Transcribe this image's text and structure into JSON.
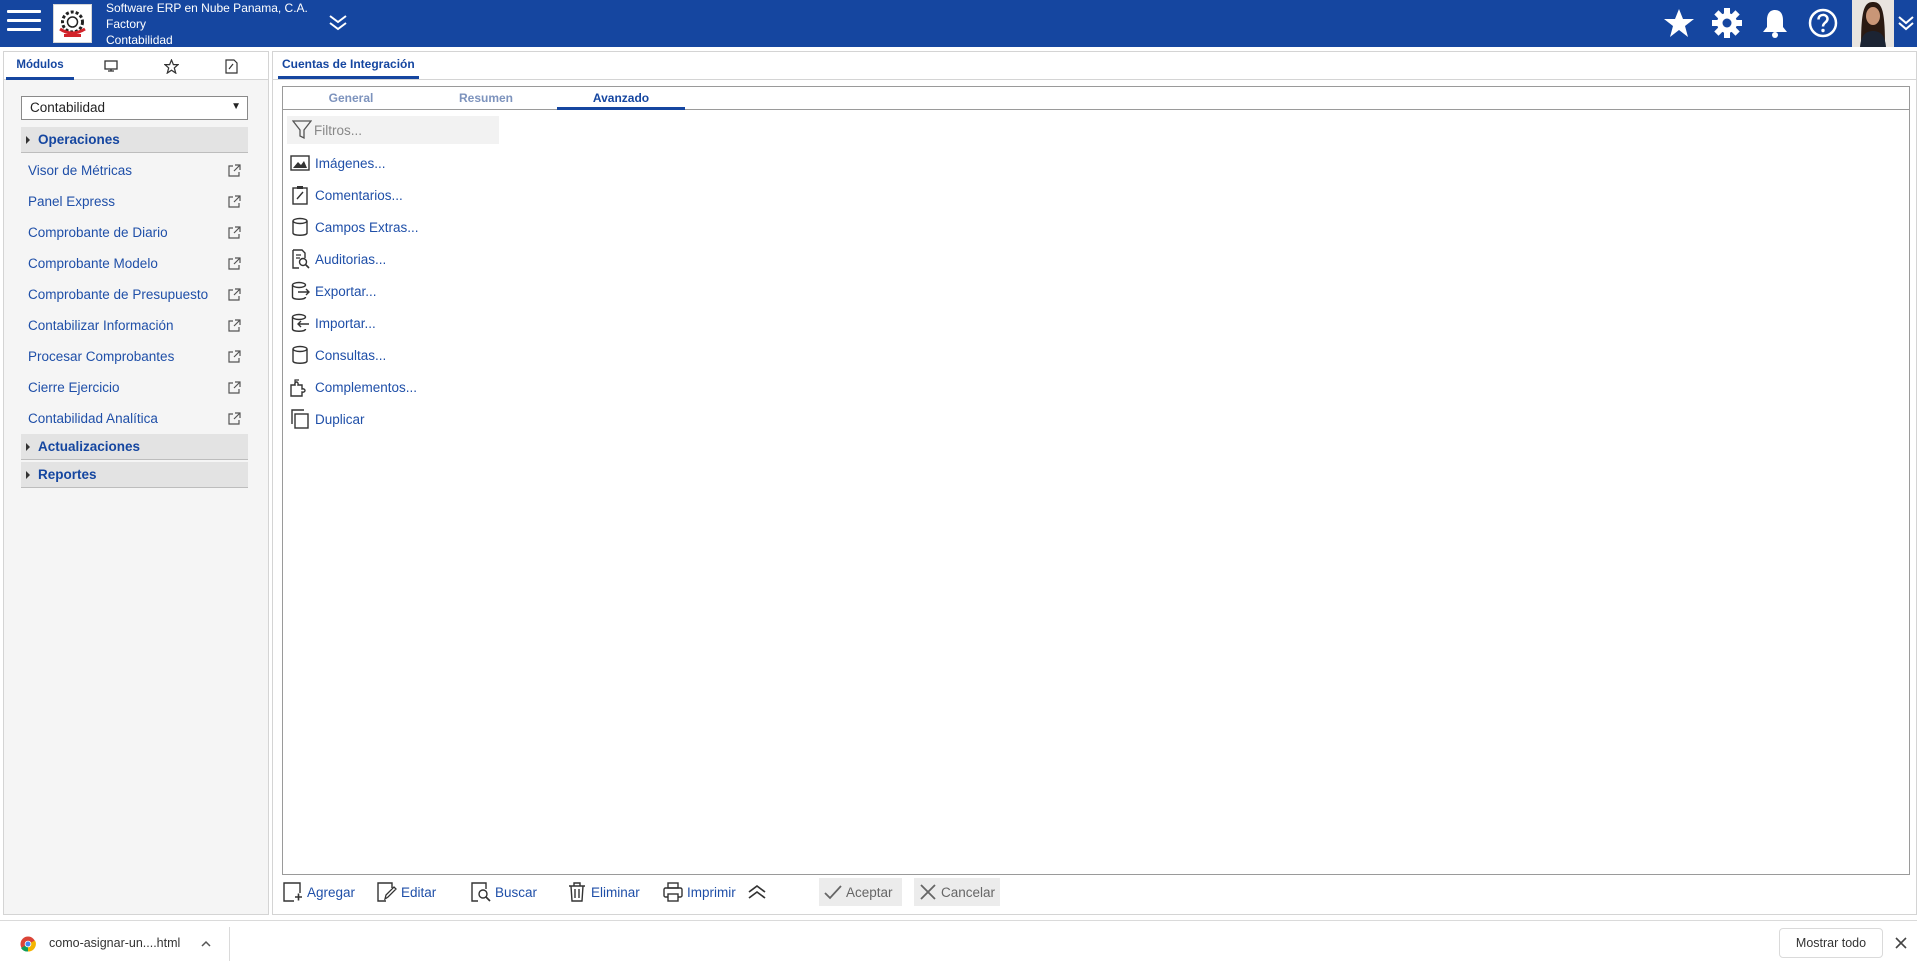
{
  "header": {
    "company_name": "Software ERP en Nube Panama, C.A.",
    "branch": "Factory",
    "module": "Contabilidad",
    "icons": [
      "menu-icon",
      "company-logo",
      "expand-icon",
      "star-icon",
      "gear-icon",
      "bell-icon",
      "help-icon",
      "avatar",
      "chevron-down-icon"
    ],
    "accent_color": "#1546a0"
  },
  "left_panel": {
    "tabs": [
      {
        "label": "Módulos",
        "icon": ""
      },
      {
        "label": "",
        "icon": "monitor-icon"
      },
      {
        "label": "",
        "icon": "star-outline-icon"
      },
      {
        "label": "",
        "icon": "document-link-icon"
      }
    ],
    "module_select": "Contabilidad",
    "sections": [
      {
        "label": "Operaciones",
        "expanded": true
      },
      {
        "label": "Actualizaciones",
        "expanded": false
      },
      {
        "label": "Reportes",
        "expanded": false
      }
    ],
    "operations": [
      "Visor de Métricas",
      "Panel Express",
      "Comprobante de Diario",
      "Comprobante Modelo",
      "Comprobante de Presupuesto",
      "Contabilizar Información",
      "Procesar Comprobantes",
      "Cierre Ejercicio",
      "Contabilidad Analítica"
    ]
  },
  "main": {
    "tab_title": "Cuentas de Integración",
    "subtabs": [
      {
        "label": "General",
        "active": false
      },
      {
        "label": "Resumen",
        "active": false
      },
      {
        "label": "Avanzado",
        "active": true
      }
    ],
    "filter_placeholder": "Filtros...",
    "actions": [
      {
        "label": "Imágenes...",
        "icon": "image-icon"
      },
      {
        "label": "Comentarios...",
        "icon": "clipboard-icon"
      },
      {
        "label": "Campos Extras...",
        "icon": "database-icon"
      },
      {
        "label": "Auditorias...",
        "icon": "audit-icon"
      },
      {
        "label": "Exportar...",
        "icon": "export-icon"
      },
      {
        "label": "Importar...",
        "icon": "import-icon"
      },
      {
        "label": "Consultas...",
        "icon": "database-icon"
      },
      {
        "label": "Complementos...",
        "icon": "puzzle-icon"
      },
      {
        "label": "Duplicar",
        "icon": "copy-icon"
      }
    ]
  },
  "toolbar": {
    "add": "Agregar",
    "edit": "Editar",
    "search": "Buscar",
    "delete": "Eliminar",
    "print": "Imprimir",
    "accept": "Aceptar",
    "cancel": "Cancelar"
  },
  "downloads": {
    "file_name": "como-asignar-un....html",
    "show_all": "Mostrar todo"
  }
}
